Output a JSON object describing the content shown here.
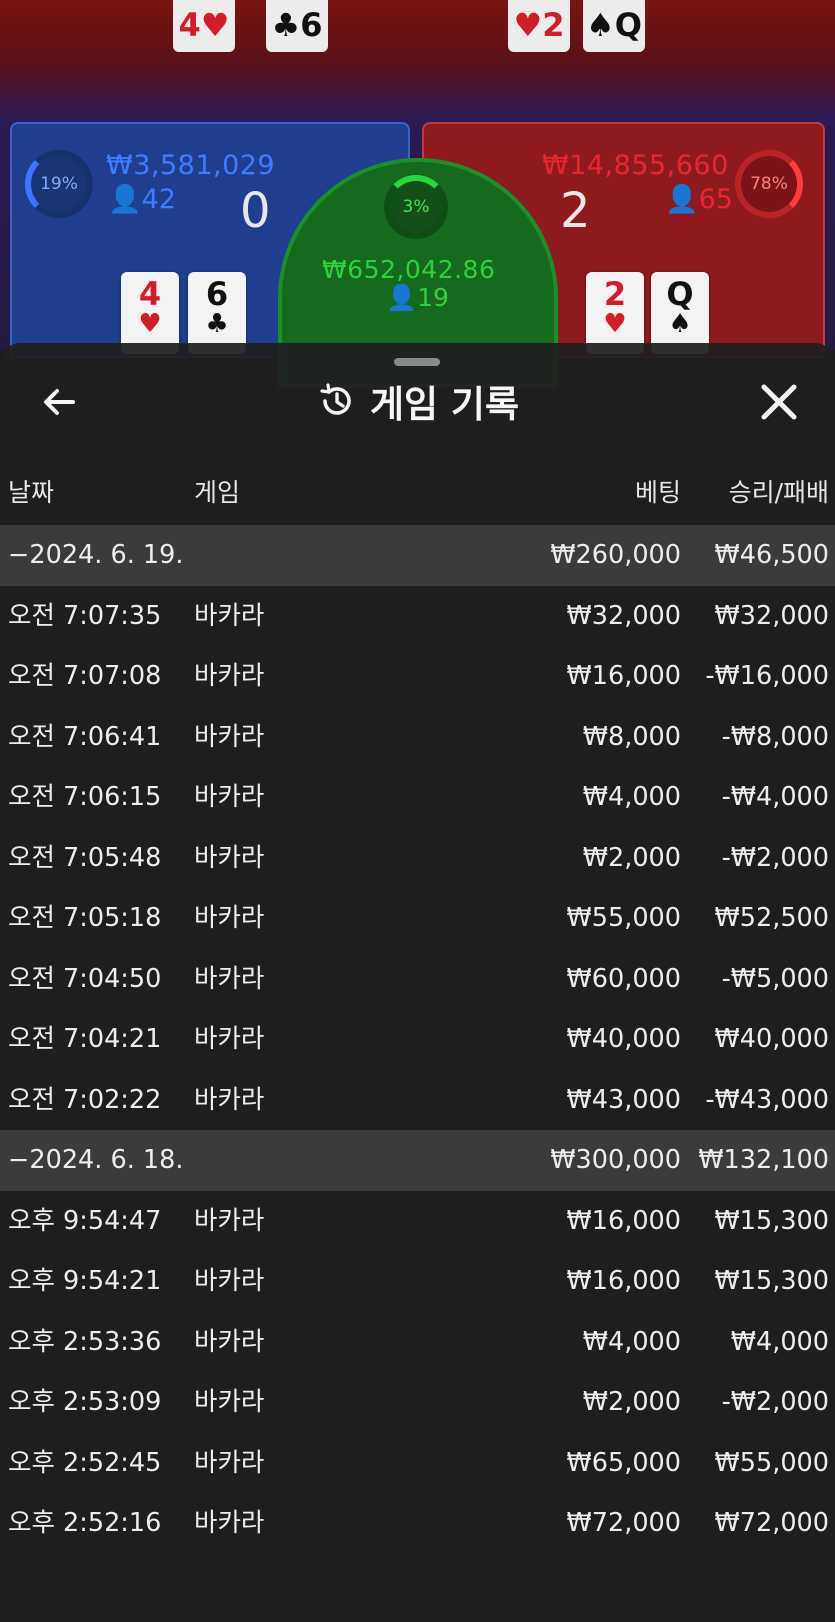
{
  "table": {
    "player": {
      "percent": "19%",
      "amount": "₩3,581,029",
      "count": "42",
      "score": "0",
      "cards": [
        {
          "rank": "4",
          "suit": "♥",
          "color": "red"
        },
        {
          "rank": "6",
          "suit": "♣",
          "color": "black"
        }
      ]
    },
    "banker": {
      "percent": "78%",
      "amount": "₩14,855,660",
      "count": "65",
      "score": "2",
      "cards": [
        {
          "rank": "2",
          "suit": "♥",
          "color": "red"
        },
        {
          "rank": "Q",
          "suit": "♠",
          "color": "black"
        }
      ]
    },
    "tie": {
      "percent": "3%",
      "amount": "₩652,042.86",
      "count": "19"
    },
    "top_cards": [
      {
        "rank": "4",
        "suit": "♥",
        "color": "red"
      },
      {
        "rank": "6",
        "suit": "♣",
        "color": "black"
      },
      {
        "rank": "2",
        "suit": "♥",
        "color": "red"
      },
      {
        "rank": "Q",
        "suit": "♠",
        "color": "black"
      }
    ],
    "colors": {
      "player": "#1f3f8e",
      "banker": "#8e1a1e",
      "tie": "#156a1d",
      "player_text": "#3f7dff",
      "banker_text": "#e8262b",
      "tie_text": "#2fd23d"
    }
  },
  "sheet": {
    "title": "게임 기록",
    "back_icon": "arrow-left-icon",
    "history_icon": "history-icon",
    "close_icon": "close-icon",
    "columns": {
      "date": "날짜",
      "game": "게임",
      "bet": "베팅",
      "result": "승리/패배"
    },
    "rows": [
      {
        "type": "group",
        "date": "−2024. 6. 19.",
        "bet": "₩260,000",
        "result": "₩46,500"
      },
      {
        "type": "item",
        "date": "오전 7:07:35",
        "game": "바카라",
        "bet": "₩32,000",
        "result": "₩32,000"
      },
      {
        "type": "item",
        "date": "오전 7:07:08",
        "game": "바카라",
        "bet": "₩16,000",
        "result": "-₩16,000"
      },
      {
        "type": "item",
        "date": "오전 7:06:41",
        "game": "바카라",
        "bet": "₩8,000",
        "result": "-₩8,000"
      },
      {
        "type": "item",
        "date": "오전 7:06:15",
        "game": "바카라",
        "bet": "₩4,000",
        "result": "-₩4,000"
      },
      {
        "type": "item",
        "date": "오전 7:05:48",
        "game": "바카라",
        "bet": "₩2,000",
        "result": "-₩2,000"
      },
      {
        "type": "item",
        "date": "오전 7:05:18",
        "game": "바카라",
        "bet": "₩55,000",
        "result": "₩52,500"
      },
      {
        "type": "item",
        "date": "오전 7:04:50",
        "game": "바카라",
        "bet": "₩60,000",
        "result": "-₩5,000"
      },
      {
        "type": "item",
        "date": "오전 7:04:21",
        "game": "바카라",
        "bet": "₩40,000",
        "result": "₩40,000"
      },
      {
        "type": "item",
        "date": "오전 7:02:22",
        "game": "바카라",
        "bet": "₩43,000",
        "result": "-₩43,000"
      },
      {
        "type": "group",
        "date": "−2024. 6. 18.",
        "bet": "₩300,000",
        "result": "₩132,100"
      },
      {
        "type": "item",
        "date": "오후 9:54:47",
        "game": "바카라",
        "bet": "₩16,000",
        "result": "₩15,300"
      },
      {
        "type": "item",
        "date": "오후 9:54:21",
        "game": "바카라",
        "bet": "₩16,000",
        "result": "₩15,300"
      },
      {
        "type": "item",
        "date": "오후 2:53:36",
        "game": "바카라",
        "bet": "₩4,000",
        "result": "₩4,000"
      },
      {
        "type": "item",
        "date": "오후 2:53:09",
        "game": "바카라",
        "bet": "₩2,000",
        "result": "-₩2,000"
      },
      {
        "type": "item",
        "date": "오후 2:52:45",
        "game": "바카라",
        "bet": "₩65,000",
        "result": "₩55,000"
      },
      {
        "type": "item",
        "date": "오후 2:52:16",
        "game": "바카라",
        "bet": "₩72,000",
        "result": "₩72,000"
      }
    ]
  }
}
